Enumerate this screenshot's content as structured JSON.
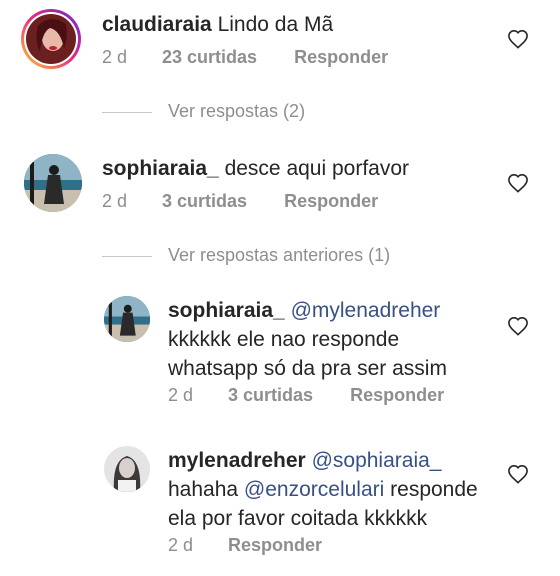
{
  "comments": [
    {
      "username": "claudiaraia",
      "text": "Lindo da Mã",
      "time": "2 d",
      "likes": "23 curtidas",
      "reply": "Responder"
    },
    {
      "username": "sophiaraia_",
      "text": "desce aqui porfavor",
      "time": "2 d",
      "likes": "3 curtidas",
      "reply": "Responder"
    }
  ],
  "view_replies_1": "Ver respostas (2)",
  "view_replies_2": "Ver respostas anteriores (1)",
  "replies": [
    {
      "username": "sophiaraia_",
      "mention": "@mylenadreher",
      "text": "kkkkkk ele nao responde whatsapp só da pra ser assim",
      "time": "2 d",
      "likes": "3 curtidas",
      "reply": "Responder"
    },
    {
      "username": "mylenadreher",
      "mention": "@sophiaraia_",
      "text_before": "hahaha",
      "mention2": "@enzorcelulari",
      "text_after": "responde ela por favor coitada kkkkkk",
      "time": "2 d",
      "reply": "Responder"
    }
  ],
  "icons": {
    "like": "heart-outline-icon"
  },
  "colors": {
    "mention": "#385185",
    "meta": "#8e8e8e",
    "story_ring": "#d6249f"
  }
}
